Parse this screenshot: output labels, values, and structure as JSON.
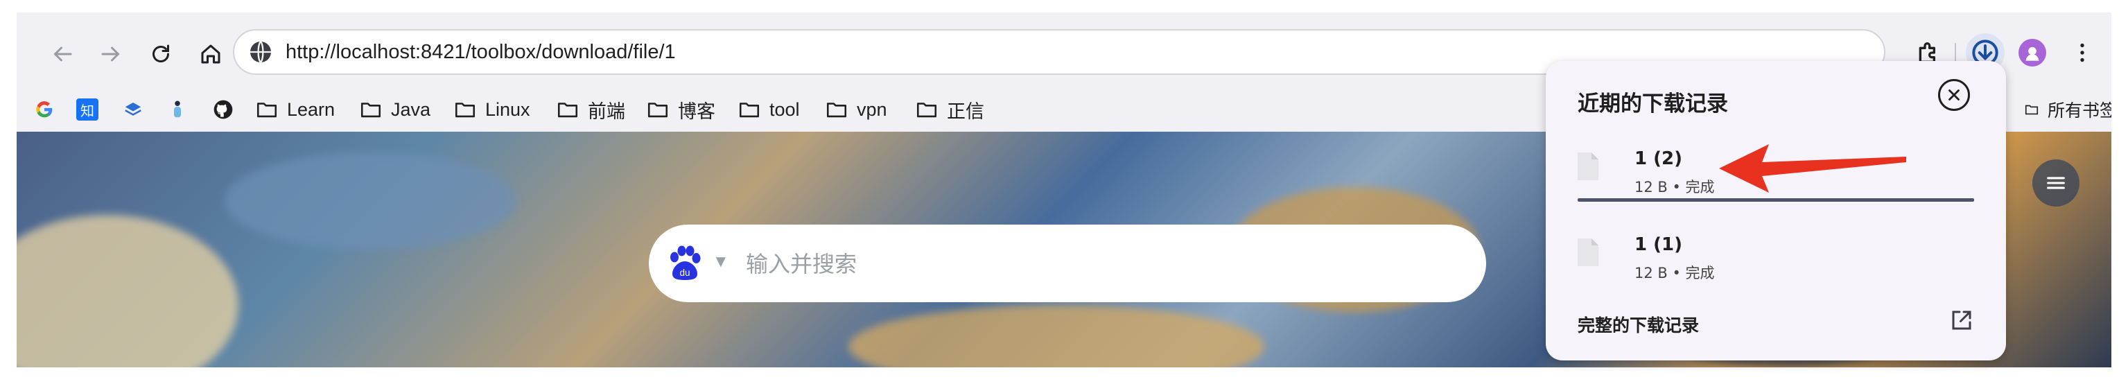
{
  "browser": {
    "url": "http://localhost:8421/toolbox/download/file/1"
  },
  "bookmarks": {
    "folders": [
      "Learn",
      "Java",
      "Linux",
      "前端",
      "博客",
      "tool",
      "vpn",
      "正信"
    ],
    "all_bookmarks": "所有书签",
    "icons": [
      "google-icon",
      "zhihu-icon",
      "layers-icon",
      "figure-icon",
      "github-icon"
    ]
  },
  "newtab": {
    "search_placeholder": "输入并搜索",
    "search_engine": "baidu-icon"
  },
  "downloads": {
    "title": "近期的下载记录",
    "items": [
      {
        "name": "1 (2)",
        "meta": "12 B • 完成"
      },
      {
        "name": "1 (1)",
        "meta": "12 B • 完成"
      }
    ],
    "full_history": "完整的下载记录"
  },
  "colors": {
    "annotation_arrow": "#e8321f",
    "download_button_bg": "#dde3f2",
    "profile_avatar": "#a865d8"
  }
}
